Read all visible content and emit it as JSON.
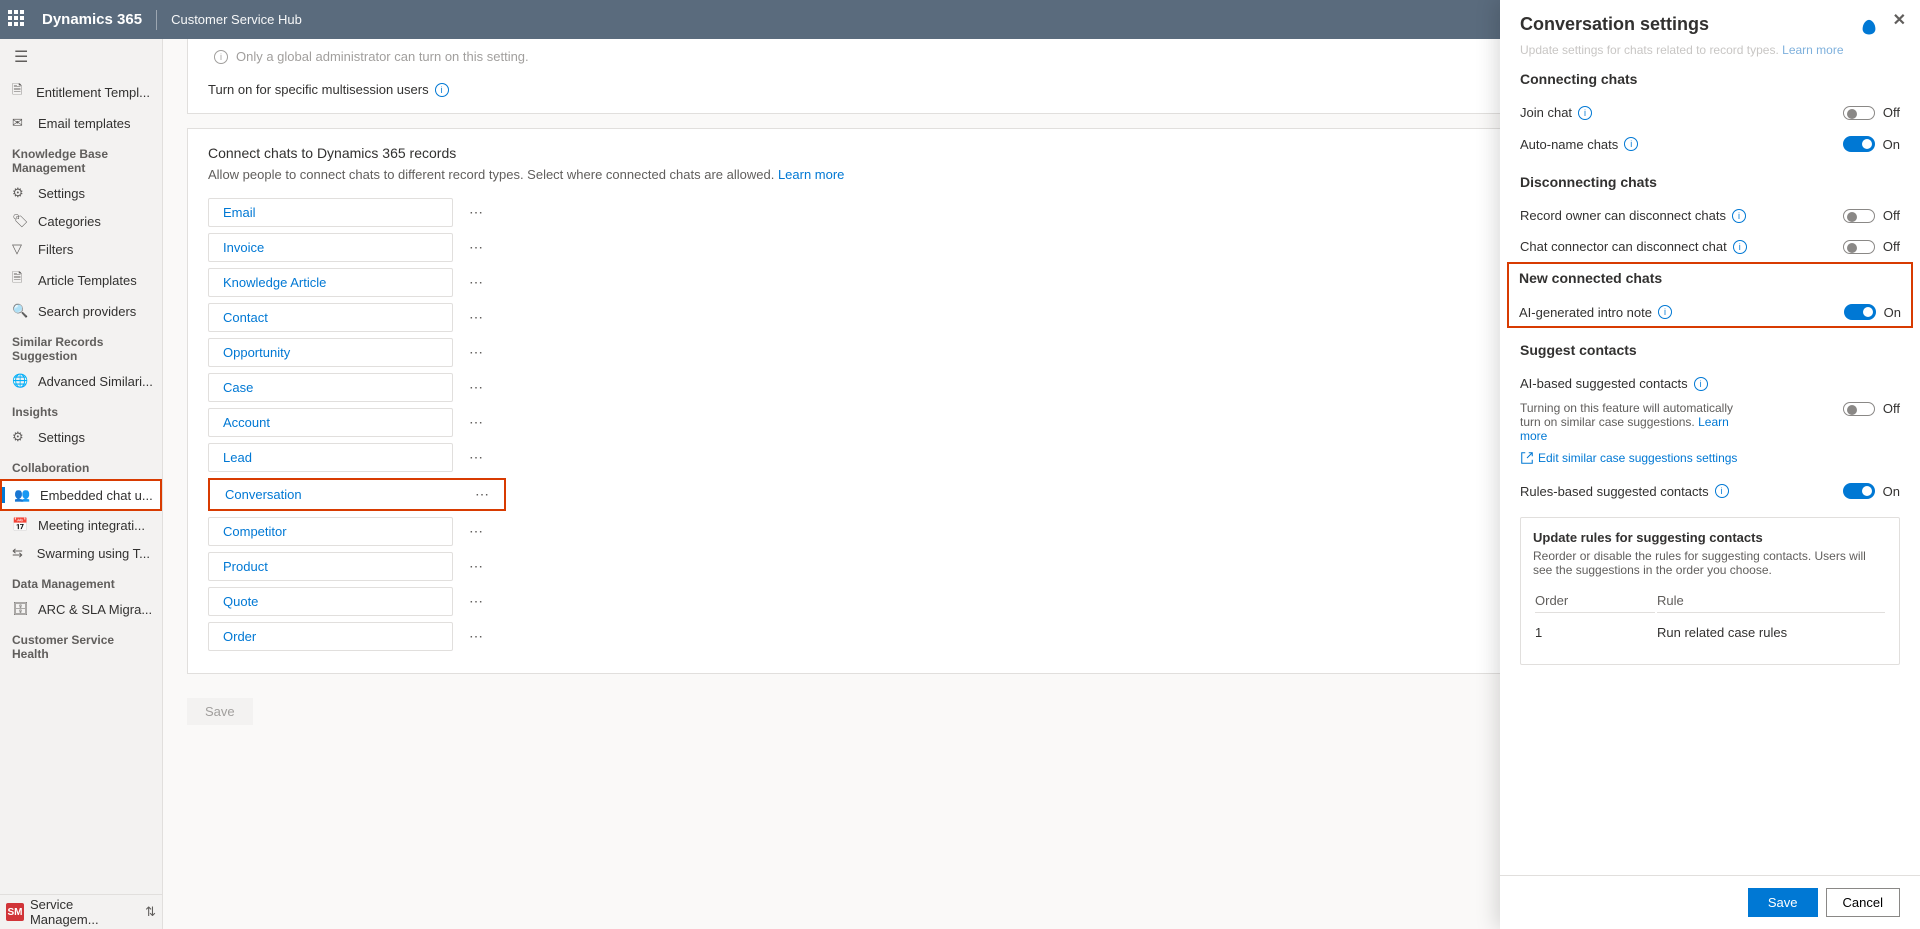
{
  "header": {
    "product": "Dynamics 365",
    "app": "Customer Service Hub"
  },
  "sidebar": {
    "items1": [
      {
        "label": "Entitlement Templ...",
        "id": "entitlement"
      },
      {
        "label": "Email templates",
        "id": "email-templates"
      }
    ],
    "heading_kb": "Knowledge Base Management",
    "items_kb": [
      {
        "label": "Settings"
      },
      {
        "label": "Categories"
      },
      {
        "label": "Filters"
      },
      {
        "label": "Article Templates"
      },
      {
        "label": "Search providers"
      }
    ],
    "heading_sr": "Similar Records Suggestion",
    "items_sr": [
      {
        "label": "Advanced Similari..."
      }
    ],
    "heading_insights": "Insights",
    "items_insights": [
      {
        "label": "Settings"
      }
    ],
    "heading_collab": "Collaboration",
    "items_collab": [
      {
        "label": "Embedded chat u...",
        "active": true
      },
      {
        "label": "Meeting integrati..."
      },
      {
        "label": "Swarming using T..."
      }
    ],
    "heading_data": "Data Management",
    "items_data": [
      {
        "label": "ARC & SLA Migra..."
      }
    ],
    "heading_csh": "Customer Service Health",
    "area_badge": "SM",
    "area_label": "Service Managem..."
  },
  "main": {
    "admin_only": "Only a global administrator can turn on this setting.",
    "multisession_label": "Turn on for specific multisession users",
    "card_title": "Connect chats to Dynamics 365 records",
    "card_desc": "Allow people to connect chats to different record types. Select where connected chats are allowed. ",
    "learn_more": "Learn more",
    "records": [
      "Email",
      "Invoice",
      "Knowledge Article",
      "Contact",
      "Opportunity",
      "Case",
      "Account",
      "Lead",
      "Conversation",
      "Competitor",
      "Product",
      "Quote",
      "Order"
    ],
    "save_label": "Save"
  },
  "panel": {
    "title": "Conversation settings",
    "fade_text": "Update settings for chats related to record types. ",
    "fade_learn": "Learn more",
    "s_connecting": "Connecting chats",
    "row_join": "Join chat",
    "row_autoname": "Auto-name chats",
    "s_disconnecting": "Disconnecting chats",
    "row_owner_disc": "Record owner can disconnect chats",
    "row_connector_disc": "Chat connector can disconnect chat",
    "s_new": "New connected chats",
    "row_ai_intro": "AI-generated intro note",
    "s_suggest": "Suggest contacts",
    "row_ai_suggest": "AI-based suggested contacts",
    "helper_text": "Turning on this feature will automatically turn on similar case suggestions. ",
    "helper_learn": "Learn more",
    "edit_link": "Edit similar case suggestions settings",
    "row_rules": "Rules-based suggested contacts",
    "rules_title": "Update rules for suggesting contacts",
    "rules_desc": "Reorder or disable the rules for suggesting contacts. Users will see the suggestions in the order you choose.",
    "col_order": "Order",
    "col_rule": "Rule",
    "rule1_order": "1",
    "rule1_name": "Run related case rules",
    "save": "Save",
    "cancel": "Cancel",
    "off": "Off",
    "on": "On"
  }
}
